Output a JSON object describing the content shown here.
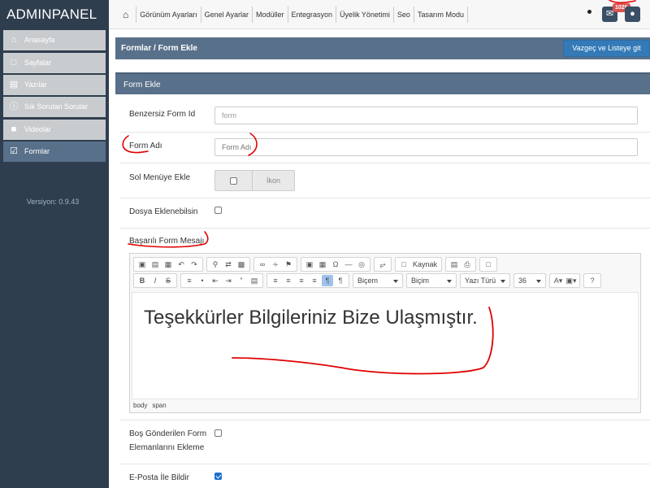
{
  "brand": "ADMINPANEL",
  "nav": {
    "items": [
      "Görünüm Ayarları",
      "Genel Ayarlar",
      "Modüller",
      "Entegrasyon",
      "Üyelik Yönetimi",
      "Seo",
      "Tasarım Modu"
    ],
    "notification_count": "1026"
  },
  "sidebar": {
    "items": [
      {
        "label": "Anasayfa",
        "icon": "home-icon"
      },
      {
        "label": "Sayfalar",
        "icon": "file-icon"
      },
      {
        "label": "Yazılar",
        "icon": "document-icon"
      },
      {
        "label": "Sık Sorulan Sorular",
        "icon": "info-icon"
      },
      {
        "label": "Videolar",
        "icon": "video-camera-icon"
      },
      {
        "label": "Formlar",
        "icon": "checkbox-icon"
      }
    ],
    "version": "Versiyon: 0.9.43"
  },
  "breadcrumb": "Formlar / Form Ekle",
  "cancel_button": "Vazgeç ve Listeye git",
  "panel_title": "Form Ekle",
  "form": {
    "unique_id_label": "Benzersiz Form Id",
    "unique_id_value": "form",
    "form_name_label": "Form Adı",
    "form_name_placeholder": "Form Adı",
    "side_menu_label": "Sol Menüye Ekle",
    "icon_label": "İkon",
    "file_upload_label": "Dosya Eklenebilsin",
    "success_message_label": "Başarılı Form Mesajı",
    "empty_elements_label": "Boş Gönderilen Form Elemanlarını Ekleme",
    "email_notify_label": "E-Posta İle Bildir"
  },
  "editor": {
    "source_label": "Kaynak",
    "format_combo": "Biçem",
    "style_combo": "Biçim",
    "font_combo": "Yazı Türü",
    "size_combo": "36",
    "content": "Teşekkürler Bilgileriniz Bize Ulaşmıştır.",
    "path": [
      "body",
      "span"
    ]
  },
  "colors": {
    "sidebar_bg": "#2f3e4e",
    "panel_header": "#587089",
    "primary_button": "#337ab7",
    "annotation": "#e00000"
  }
}
